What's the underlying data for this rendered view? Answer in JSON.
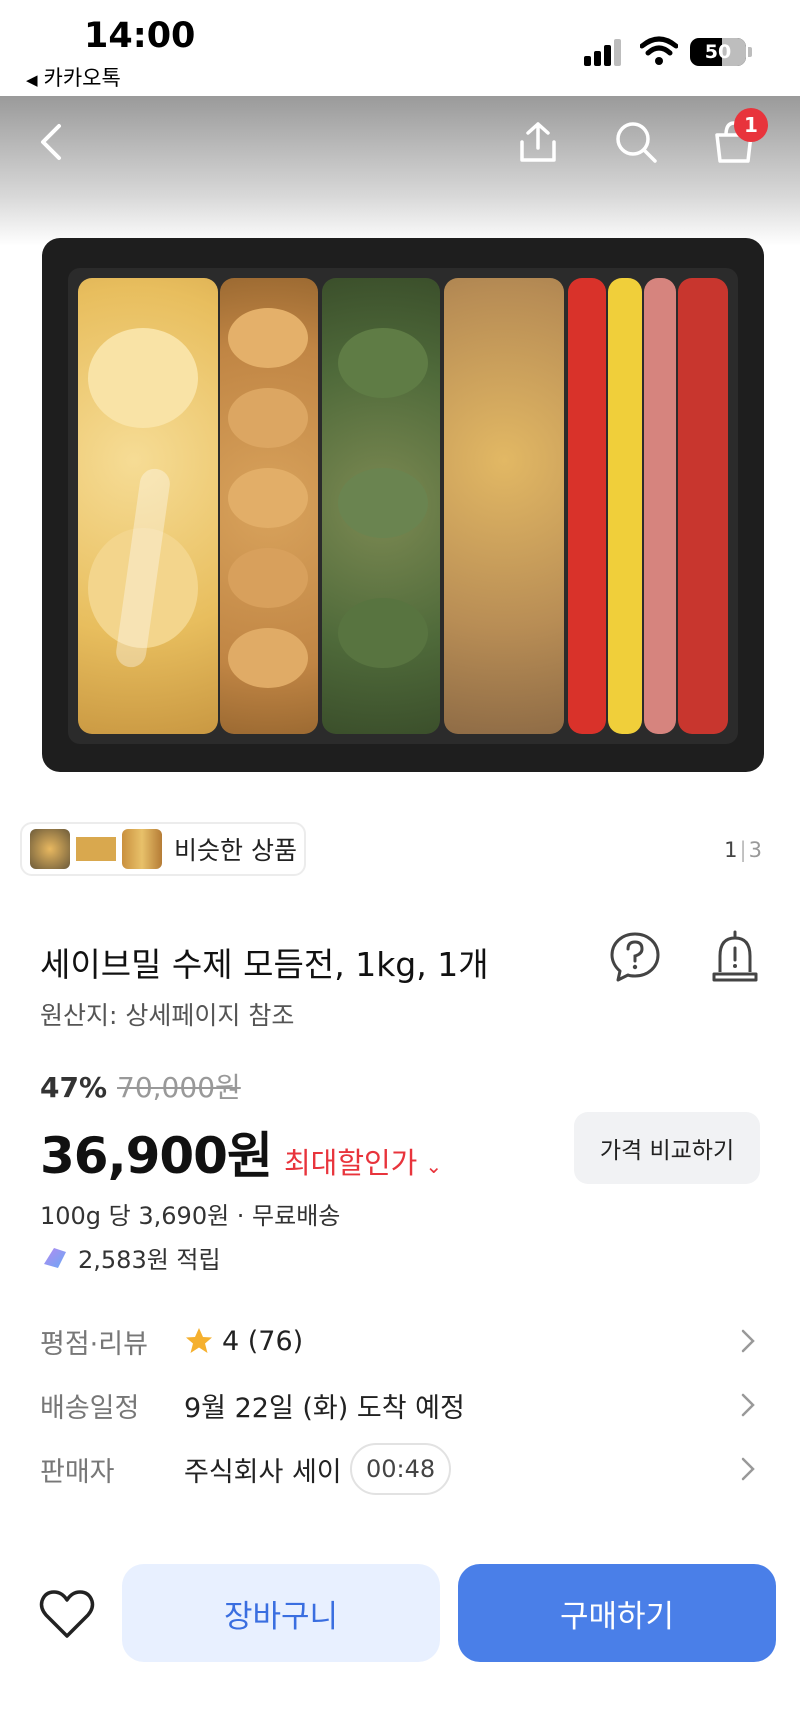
{
  "status_bar": {
    "time": "14:00",
    "back_app": "카카오톡",
    "battery": "50"
  },
  "top_nav": {
    "cart_count": "1"
  },
  "similar": {
    "label": "비슷한 상품"
  },
  "pager": {
    "current": "1",
    "separator": "|",
    "total": "3"
  },
  "product": {
    "title": "세이브밀 수제 모듬전, 1kg, 1개",
    "origin": "원산지: 상세페이지 참조",
    "discount_rate": "47%",
    "original_price": "70,000원",
    "price": "36,900원",
    "price_tag": "최대할인가",
    "compare_label": "가격 비교하기",
    "unit_price": "100g 당 3,690원 · 무료배송",
    "points": "2,583원 적립"
  },
  "info": {
    "rating_label": "평점·리뷰",
    "rating_value": "4 (76)",
    "delivery_label": "배송일정",
    "delivery_value": "9월 22일 (화) 도착 예정",
    "seller_label": "판매자",
    "seller_value": "주식회사 세이",
    "timer": "00:48"
  },
  "actions": {
    "cart": "장바구니",
    "buy": "구매하기"
  },
  "colors": {
    "accent_blue": "#4a7fe8",
    "sale_red": "#e8343c",
    "star": "#f5b02e"
  }
}
